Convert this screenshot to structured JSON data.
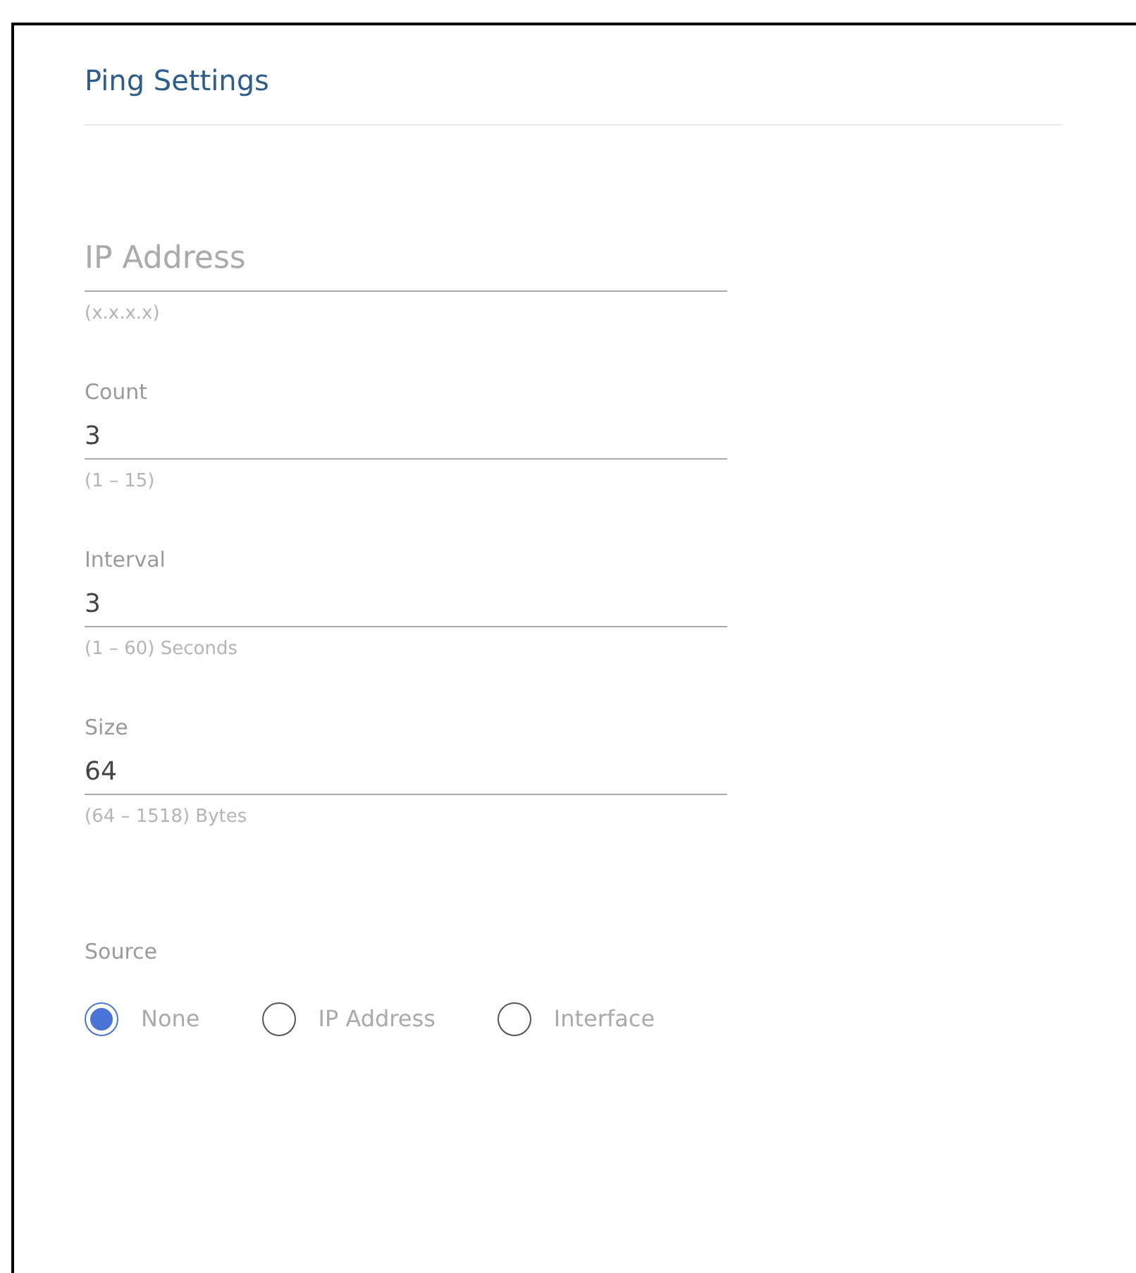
{
  "title": "Ping Settings",
  "fields": [
    {
      "placeholder": "IP Address",
      "hint": "(x.x.x.x)"
    },
    {
      "label": "Count",
      "value": "3",
      "hint": "(1 – 15)"
    },
    {
      "label": "Interval",
      "value": "3",
      "hint": "(1 – 60) Seconds"
    },
    {
      "label": "Size",
      "value": "64",
      "hint": "(64 – 1518) Bytes"
    }
  ],
  "source": {
    "label": "Source",
    "options": [
      {
        "label": "None",
        "selected": true
      },
      {
        "label": "IP Address",
        "selected": false
      },
      {
        "label": "Interface",
        "selected": false
      }
    ]
  }
}
